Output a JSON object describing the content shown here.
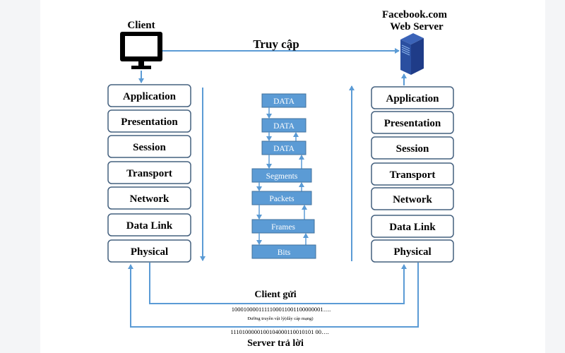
{
  "client": {
    "label": "Client",
    "icon": "monitor-icon"
  },
  "server": {
    "label_line1": "Facebook.com",
    "label_line2": "Web Server",
    "icon": "server-icon"
  },
  "access_label": "Truy cập",
  "client_layers": [
    "Application",
    "Presentation",
    "Session",
    "Transport",
    "Network",
    "Data Link",
    "Physical"
  ],
  "server_layers": [
    "Application",
    "Presentation",
    "Session",
    "Transport",
    "Network",
    "Data Link",
    "Physical"
  ],
  "encapsulation": [
    "DATA",
    "DATA",
    "DATA",
    "Segments",
    "Packets",
    "Frames",
    "Bits"
  ],
  "client_send_label": "Client gửi",
  "client_bits": "1000100001111100011001100000001….",
  "medium_label": "Đường truyền vật lý(dây cáp mạng)",
  "server_bits": "1110100000100104000110010101 00….",
  "server_reply_label": "Server trả lời",
  "colors": {
    "line": "#5b9bd5",
    "box_fill": "#5b9bd5",
    "box_border": "#41719c",
    "layer_border": "#44607e",
    "server": "#1f3c88"
  }
}
